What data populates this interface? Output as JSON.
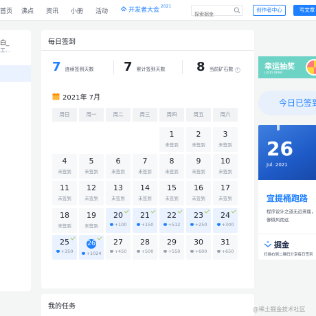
{
  "nav": {
    "items": [
      "首页",
      "沸点",
      "资讯",
      "小册",
      "活动"
    ],
    "dev_conf": "开发者大会",
    "dev_conf_year": "2021",
    "search_placeholder": "探索掘金",
    "creator_label": "创作者中心",
    "write_label": "写文章"
  },
  "left": {
    "title_fragment": "白_",
    "subtitle_fragment": "工..."
  },
  "checkin": {
    "title": "每日签到",
    "stats": [
      {
        "value": "7",
        "label": "连续签到天数",
        "color": "#1e80ff"
      },
      {
        "value": "7",
        "label": "累计签到天数",
        "color": "#1d2129"
      },
      {
        "value": "8",
        "label": "当前矿石数",
        "color": "#1d2129"
      }
    ],
    "help_mark": "?",
    "month_label": "2021年 7月",
    "weekdays": [
      "周日",
      "周一",
      "周二",
      "周三",
      "周四",
      "周五",
      "周六"
    ],
    "days": [
      {
        "day": "1",
        "status": "未签到",
        "signed": false
      },
      {
        "day": "2",
        "status": "未签到",
        "signed": false
      },
      {
        "day": "3",
        "status": "未签到",
        "signed": false
      },
      {
        "day": "4",
        "status": "未签到",
        "signed": false
      },
      {
        "day": "5",
        "status": "未签到",
        "signed": false
      },
      {
        "day": "6",
        "status": "未签到",
        "signed": false
      },
      {
        "day": "7",
        "status": "未签到",
        "signed": false
      },
      {
        "day": "8",
        "status": "未签到",
        "signed": false
      },
      {
        "day": "9",
        "status": "未签到",
        "signed": false
      },
      {
        "day": "10",
        "status": "未签到",
        "signed": false
      },
      {
        "day": "11",
        "status": "未签到",
        "signed": false
      },
      {
        "day": "12",
        "status": "未签到",
        "signed": false
      },
      {
        "day": "13",
        "status": "未签到",
        "signed": false
      },
      {
        "day": "14",
        "status": "未签到",
        "signed": false
      },
      {
        "day": "15",
        "status": "未签到",
        "signed": false
      },
      {
        "day": "16",
        "status": "未签到",
        "signed": false
      },
      {
        "day": "17",
        "status": "未签到",
        "signed": false
      },
      {
        "day": "18",
        "status": "未签到",
        "signed": false
      },
      {
        "day": "19",
        "status": "未签到",
        "signed": false
      },
      {
        "day": "20",
        "status": "+100",
        "signed": true
      },
      {
        "day": "21",
        "status": "+150",
        "signed": true
      },
      {
        "day": "22",
        "status": "+512",
        "signed": true
      },
      {
        "day": "23",
        "status": "+250",
        "signed": true
      },
      {
        "day": "24",
        "status": "+300",
        "signed": true
      },
      {
        "day": "25",
        "status": "+350",
        "signed": true
      },
      {
        "day": "26",
        "status": "+1024",
        "signed": true,
        "today": true
      },
      {
        "day": "27",
        "status": "+450",
        "signed": false
      },
      {
        "day": "28",
        "status": "+500",
        "signed": false
      },
      {
        "day": "29",
        "status": "+550",
        "signed": false
      },
      {
        "day": "30",
        "status": "+600",
        "signed": false
      },
      {
        "day": "31",
        "status": "+650",
        "signed": false
      }
    ],
    "first_weekday": 4
  },
  "tasks": {
    "title": "我的任务"
  },
  "right": {
    "lucky_title": "幸运抽奖",
    "lucky_sub": "LUCKY DRAW",
    "signed_label": "今日已签到",
    "date_day": "26",
    "date_month": "Jul. 2021",
    "date_heading": "宜提桶跑路",
    "date_text_1": "程序设计之道无远弗届，",
    "date_text_2": "御微风而远",
    "brand": "掘金",
    "brand_caption": "扫描右侧二维码分享每日签到"
  },
  "watermark": "@稀土掘金技术社区",
  "colors": {
    "accent": "#1e80ff",
    "signed_bg": "#eaf2ff",
    "plain_bg": "#f7f8fa"
  }
}
